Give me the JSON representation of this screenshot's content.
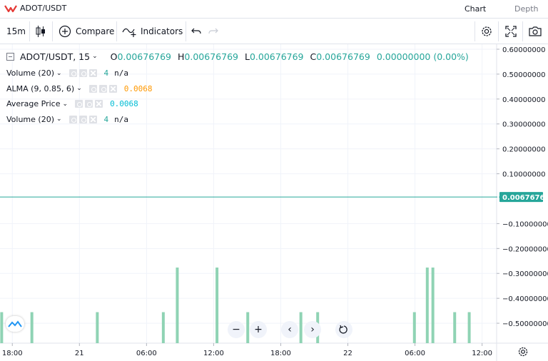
{
  "header": {
    "pair": "ADOT/USDT",
    "tabs": [
      {
        "label": "Chart"
      },
      {
        "label": "Depth"
      }
    ]
  },
  "toolbar": {
    "interval": "15m",
    "compare_label": "Compare",
    "indicators_label": "Indicators"
  },
  "legend": {
    "symbol": "ADOT/USDT, 15",
    "ohlc": [
      {
        "label": "O",
        "value": "0.00676769"
      },
      {
        "label": "H",
        "value": "0.00676769"
      },
      {
        "label": "L",
        "value": "0.00676769"
      },
      {
        "label": "C",
        "value": "0.00676769"
      }
    ],
    "change": "0.00000000 (0.00%)",
    "indicators": [
      {
        "name": "Volume (20)",
        "value": "4",
        "extra": "n/a",
        "color": "#26a69a"
      },
      {
        "name": "ALMA (9, 0.85, 6)",
        "value": "0.0068",
        "extra": "",
        "color": "#ff9800"
      },
      {
        "name": "Average Price",
        "value": "0.0068",
        "extra": "",
        "color": "#00bcd4"
      },
      {
        "name": "Volume (20)",
        "value": "4",
        "extra": "n/a",
        "color": "#26a69a"
      }
    ]
  },
  "colors": {
    "up": "#26a69a",
    "volume": "#8fd3b4",
    "price_line": "#26a69a",
    "grid": "#f0f3fa",
    "axis_text": "#131722"
  },
  "chart_data": {
    "type": "bar",
    "symbol": "ADOT/USDT",
    "interval": "15",
    "last_price": "0.00676769",
    "last_price_value": 0.00676769,
    "y_axis": {
      "ylim": [
        -0.58,
        0.62
      ],
      "ticks": [
        {
          "v": 0.6,
          "label": "0.60000000"
        },
        {
          "v": 0.5,
          "label": "0.50000000"
        },
        {
          "v": 0.4,
          "label": "0.40000000"
        },
        {
          "v": 0.3,
          "label": "0.30000000"
        },
        {
          "v": 0.2,
          "label": "0.20000000"
        },
        {
          "v": 0.1,
          "label": "0.10000000"
        },
        {
          "v": -0.1,
          "label": "−0.10000000"
        },
        {
          "v": -0.2,
          "label": "−0.20000000"
        },
        {
          "v": -0.3,
          "label": "−0.30000000"
        },
        {
          "v": -0.4,
          "label": "−0.40000000"
        },
        {
          "v": -0.5,
          "label": "−0.50000000"
        }
      ]
    },
    "x_axis": {
      "ticks": [
        {
          "t": 18,
          "label": "18:00"
        },
        {
          "t": 24,
          "label": "21"
        },
        {
          "t": 30,
          "label": "06:00"
        },
        {
          "t": 36,
          "label": "12:00"
        },
        {
          "t": 42,
          "label": "18:00"
        },
        {
          "t": 48,
          "label": "22"
        },
        {
          "t": 54,
          "label": "06:00"
        },
        {
          "t": 60,
          "label": "12:00"
        }
      ],
      "range_hours": [
        16.9,
        61.3
      ]
    },
    "volume_bars": [
      {
        "t": 17.05,
        "v": 1
      },
      {
        "t": 19.75,
        "v": 1
      },
      {
        "t": 25.6,
        "v": 1
      },
      {
        "t": 31.5,
        "v": 1
      },
      {
        "t": 32.75,
        "v": 2
      },
      {
        "t": 36.3,
        "v": 2
      },
      {
        "t": 39.05,
        "v": 1
      },
      {
        "t": 43.8,
        "v": 1
      },
      {
        "t": 45.3,
        "v": 1
      },
      {
        "t": 53.95,
        "v": 1
      },
      {
        "t": 55.1,
        "v": 2
      },
      {
        "t": 55.6,
        "v": 2
      },
      {
        "t": 57.55,
        "v": 1
      },
      {
        "t": 58.85,
        "v": 1
      }
    ]
  }
}
